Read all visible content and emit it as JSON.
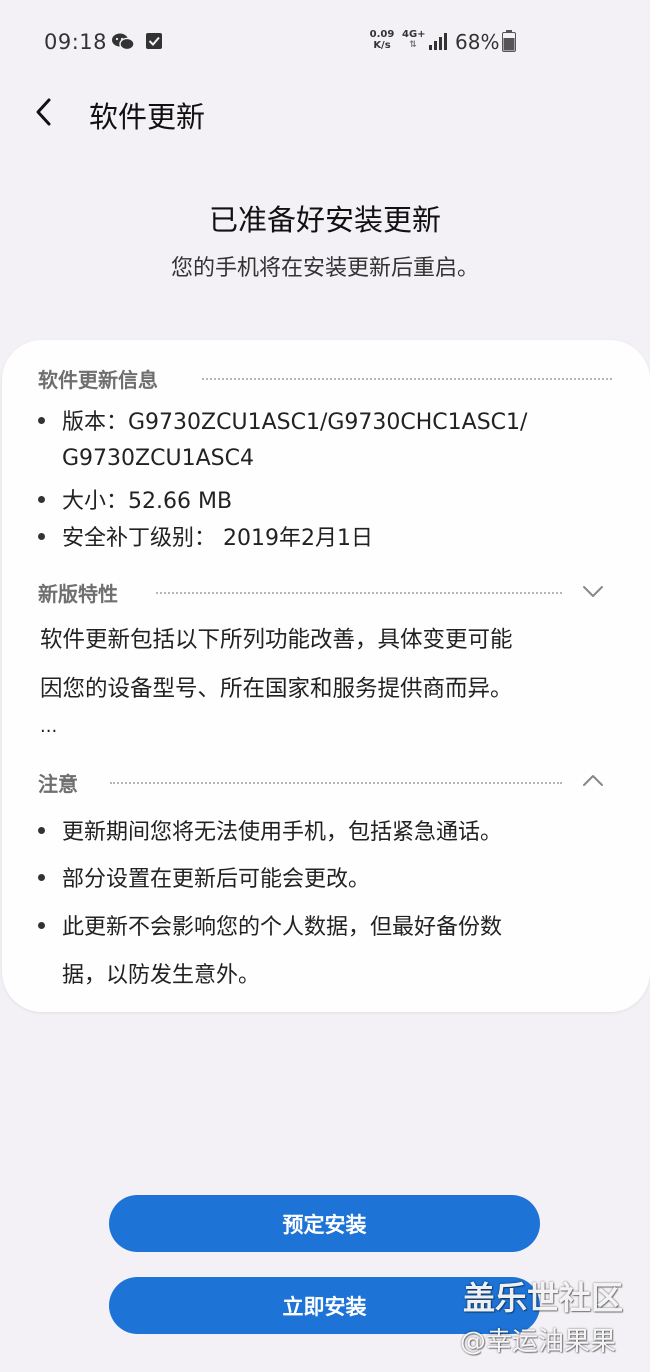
{
  "status_bar": {
    "time": "09:18",
    "speed_value": "0.09",
    "speed_unit": "K/s",
    "network": "4G+",
    "battery": "68%",
    "icons": [
      "wechat-icon",
      "checkbox-notification-icon",
      "signal-icon",
      "battery-icon"
    ]
  },
  "header": {
    "title": "软件更新",
    "back_icon": "back-arrow-icon"
  },
  "hero": {
    "title": "已准备好安装更新",
    "subtitle": "您的手机将在安装更新后重启。"
  },
  "info_section": {
    "label": "软件更新信息",
    "items": [
      "版本：G9730ZCU1ASC1/G9730CHC1ASC1/",
      "G9730ZCU1ASC4",
      "大小：52.66 MB",
      "安全补丁级别： 2019年2月1日"
    ]
  },
  "features_section": {
    "label": "新版特性",
    "lines": [
      "软件更新包括以下所列功能改善，具体变更可能",
      "因您的设备型号、所在国家和服务提供商而异。",
      "..."
    ],
    "state": "collapsed"
  },
  "notes_section": {
    "label": "注意",
    "items": [
      "更新期间您将无法使用手机，包括紧急通话。",
      "部分设置在更新后可能会更改。",
      "此更新不会影响您的个人数据，但最好备份数",
      "据，以防发生意外。"
    ],
    "state": "expanded"
  },
  "buttons": {
    "schedule": "预定安装",
    "install_now": "立即安装"
  },
  "watermark": {
    "line1": "盖乐世社区",
    "line2": "@幸运油果果"
  },
  "colors": {
    "accent": "#1d73d6",
    "background": "#f4f1f6",
    "card": "#fefefe"
  }
}
